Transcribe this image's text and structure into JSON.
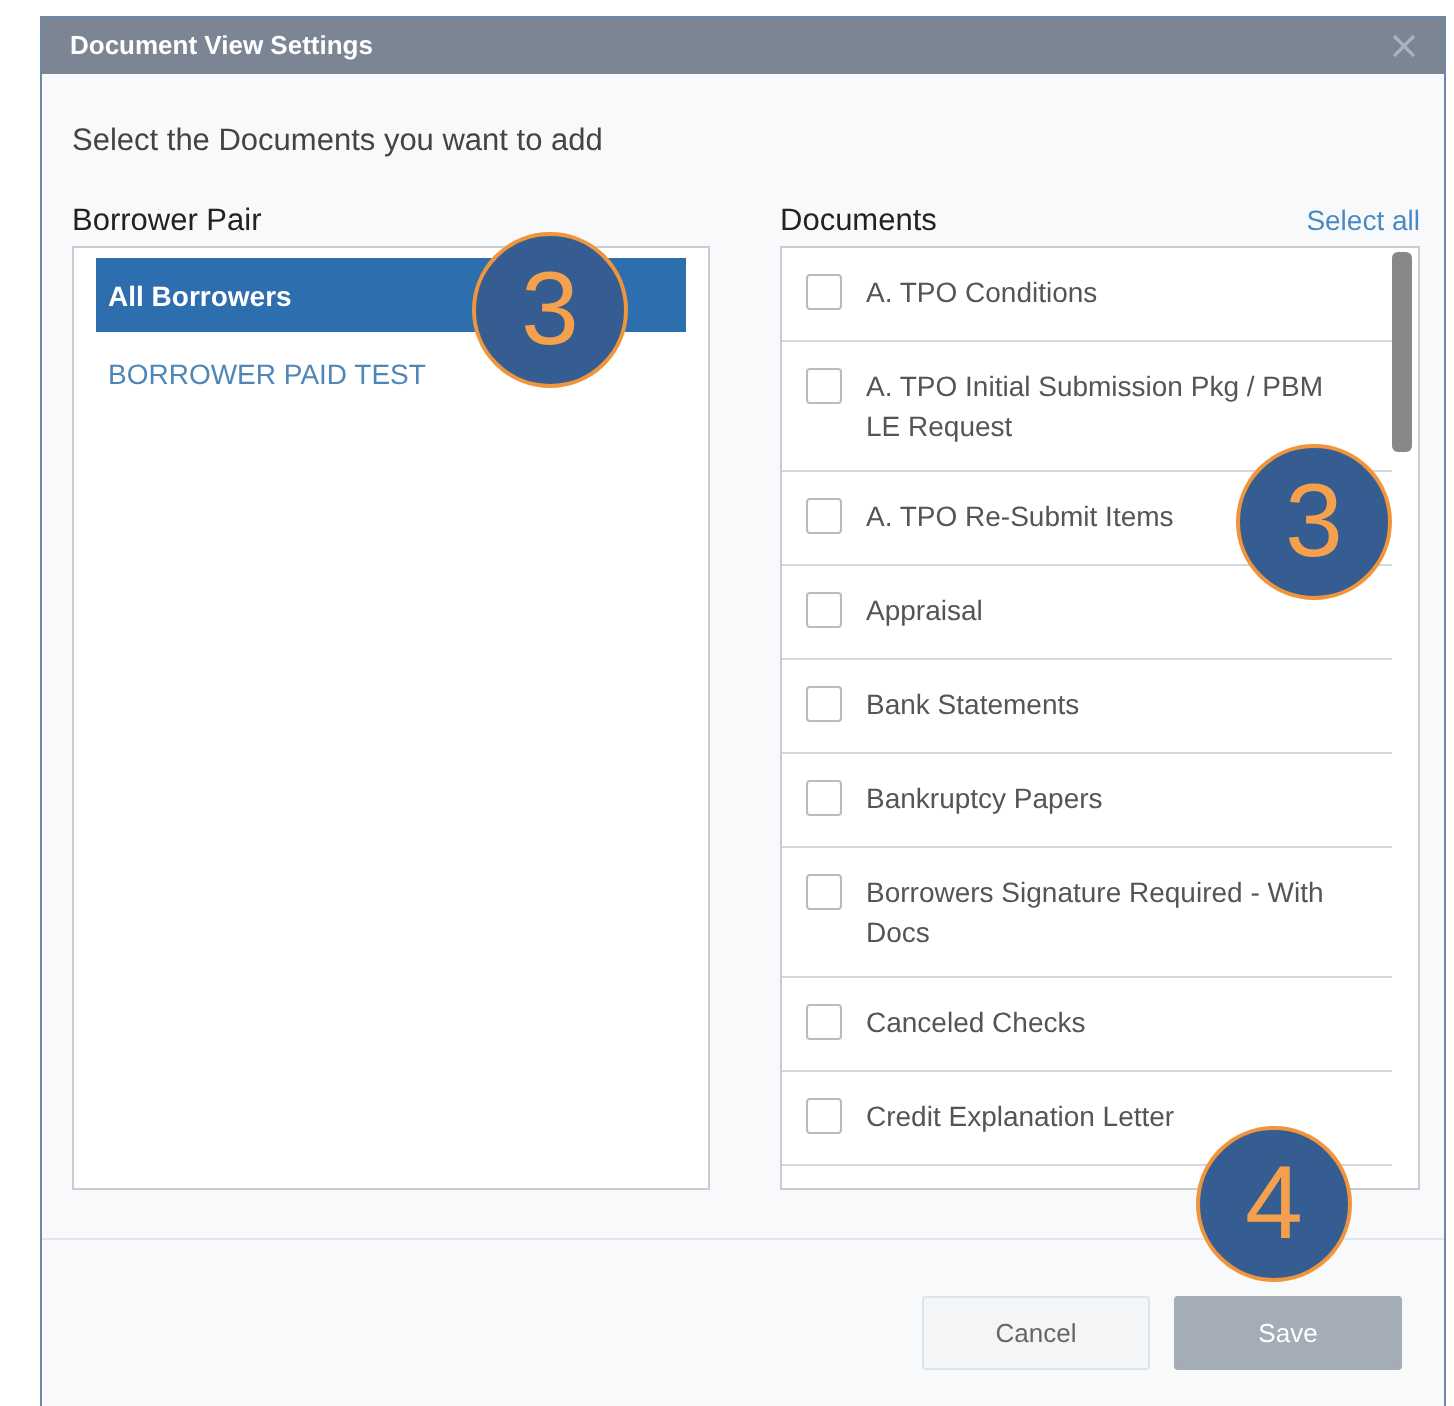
{
  "window": {
    "title": "Document View Settings"
  },
  "instruction": "Select the Documents you want to add",
  "borrower_pair": {
    "heading": "Borrower Pair",
    "items": [
      {
        "label": "All Borrowers",
        "selected": true
      },
      {
        "label": "BORROWER PAID TEST",
        "selected": false
      }
    ]
  },
  "documents": {
    "heading": "Documents",
    "select_all": "Select all",
    "items": [
      {
        "label": "A. TPO Conditions",
        "checked": false
      },
      {
        "label": "A. TPO Initial Submission Pkg / PBM LE Request",
        "checked": false
      },
      {
        "label": "A. TPO Re-Submit Items",
        "checked": false
      },
      {
        "label": "Appraisal",
        "checked": false
      },
      {
        "label": "Bank Statements",
        "checked": false
      },
      {
        "label": "Bankruptcy Papers",
        "checked": false
      },
      {
        "label": "Borrowers Signature Required - With Docs",
        "checked": false
      },
      {
        "label": "Canceled Checks",
        "checked": false
      },
      {
        "label": "Credit Explanation Letter",
        "checked": false
      }
    ]
  },
  "buttons": [
    {
      "label": "Cancel",
      "disabled": false
    },
    {
      "label": "Save",
      "disabled": true
    }
  ],
  "callouts": [
    {
      "label": "3"
    },
    {
      "label": "3"
    },
    {
      "label": "4"
    }
  ]
}
